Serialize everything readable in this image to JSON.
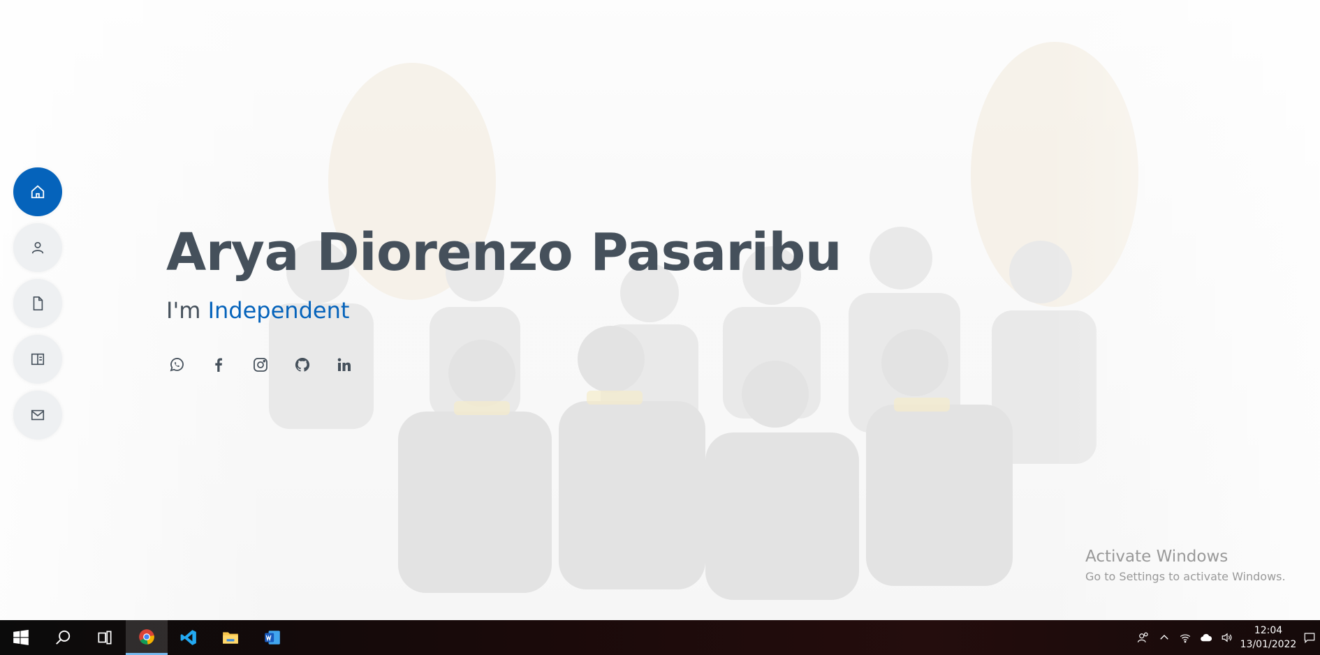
{
  "hero": {
    "name": "Arya Diorenzo Pasaribu",
    "tagline_prefix": "I'm",
    "tagline_typed": "Independent"
  },
  "nav": {
    "items": [
      {
        "icon": "home-icon",
        "active": true
      },
      {
        "icon": "person-icon",
        "active": false
      },
      {
        "icon": "file-icon",
        "active": false
      },
      {
        "icon": "book-icon",
        "active": false
      },
      {
        "icon": "envelope-icon",
        "active": false
      }
    ]
  },
  "social": [
    {
      "icon": "whatsapp-icon"
    },
    {
      "icon": "facebook-icon"
    },
    {
      "icon": "instagram-icon"
    },
    {
      "icon": "github-icon"
    },
    {
      "icon": "linkedin-icon"
    }
  ],
  "watermark": {
    "title": "Activate Windows",
    "subtitle": "Go to Settings to activate Windows."
  },
  "taskbar": {
    "apps": [
      "start-icon",
      "search-icon",
      "task-view-icon",
      "chrome-icon",
      "vscode-icon",
      "file-explorer-icon",
      "word-icon"
    ],
    "time": "12:04",
    "date": "13/01/2022"
  },
  "colors": {
    "accent": "#0563bb",
    "text": "#45505b",
    "nav_bg": "#eef0f2"
  }
}
